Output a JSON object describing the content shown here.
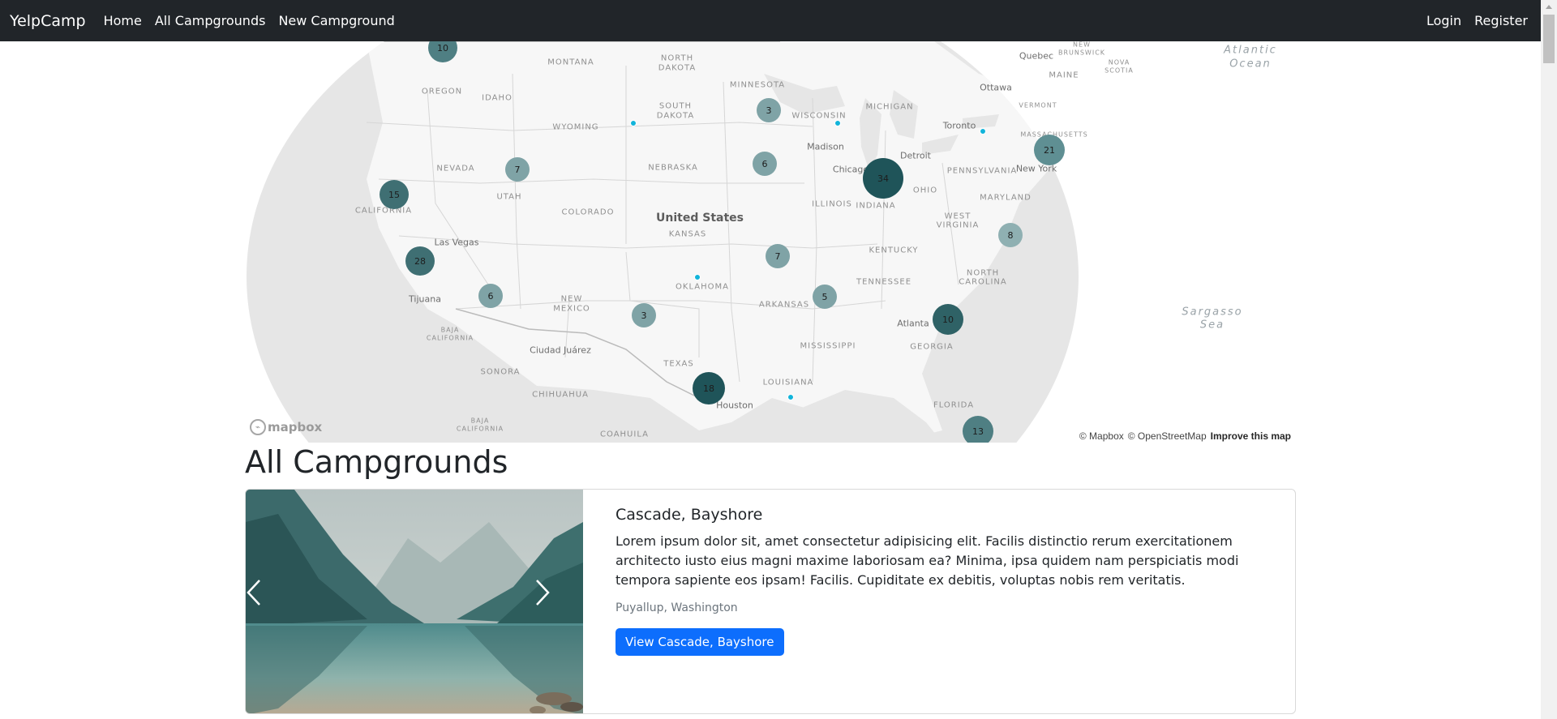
{
  "navbar": {
    "brand": "YelpCamp",
    "links": [
      {
        "label": "Home"
      },
      {
        "label": "All Campgrounds"
      },
      {
        "label": "New Campground"
      }
    ],
    "right_links": [
      {
        "label": "Login"
      },
      {
        "label": "Register"
      }
    ]
  },
  "map": {
    "labels": {
      "montana": "MONTANA",
      "north_dakota_1": "NORTH",
      "north_dakota_2": "DAKOTA",
      "south_dakota_1": "SOUTH",
      "south_dakota_2": "DAKOTA",
      "minnesota": "MINNESOTA",
      "wisconsin": "WISCONSIN",
      "michigan": "MICHIGAN",
      "oregon": "OREGON",
      "idaho": "IDAHO",
      "wyoming": "WYOMING",
      "nevada": "NEVADA",
      "utah": "UTAH",
      "colorado": "COLORADO",
      "nebraska": "NEBRASKA",
      "kansas": "KANSAS",
      "illinois": "ILLINOIS",
      "indiana": "INDIANA",
      "ohio": "OHIO",
      "pennsylvania": "PENNSYLVANIA",
      "california": "CALIFORNIA",
      "oklahoma": "OKLAHOMA",
      "new_mexico_1": "NEW",
      "new_mexico_2": "MEXICO",
      "arkansas": "ARKANSAS",
      "tennessee": "TENNESSEE",
      "kentucky": "KENTUCKY",
      "west_virginia_1": "WEST",
      "west_virginia_2": "VIRGINIA",
      "maryland": "MARYLAND",
      "north_carolina_1": "NORTH",
      "north_carolina_2": "CAROLINA",
      "georgia": "GEORGIA",
      "mississippi": "MISSISSIPPI",
      "texas": "TEXAS",
      "louisiana": "LOUISIANA",
      "florida": "FLORIDA",
      "sonora": "SONORA",
      "chihuahua": "CHIHUAHUA",
      "coahuila": "COAHUILA",
      "baja_1": "BAJA",
      "baja_2": "CALIFORNIA",
      "baja_sur_1": "BAJA",
      "baja_sur_2": "CALIFORNIA",
      "maine": "MAINE",
      "vermont": "VERMONT",
      "massachusetts": "MASSACHUSETTS",
      "new_brunswick_1": "NEW",
      "new_brunswick_2": "BRUNSWICK",
      "nova_scotia_1": "NOVA",
      "nova_scotia_2": "SCOTIA",
      "united_states": "United States",
      "las_vegas": "Las Vegas",
      "tijuana": "Tijuana",
      "ciudad_juarez": "Ciudad Juárez",
      "houston": "Houston",
      "atlanta": "Atlanta",
      "chicago": "Chicago",
      "detroit": "Detroit",
      "madison": "Madison",
      "toronto": "Toronto",
      "ottawa": "Ottawa",
      "quebec": "Quebec",
      "new_york": "New York",
      "atlantic_1": "Atlantic",
      "atlantic_2": "Ocean",
      "sargasso_1": "Sargasso",
      "sargasso_2": "Sea"
    },
    "clusters": [
      {
        "count": "10"
      },
      {
        "count": "3"
      },
      {
        "count": "6"
      },
      {
        "count": "7"
      },
      {
        "count": "15"
      },
      {
        "count": "34"
      },
      {
        "count": "21"
      },
      {
        "count": "28"
      },
      {
        "count": "7"
      },
      {
        "count": "8"
      },
      {
        "count": "6"
      },
      {
        "count": "5"
      },
      {
        "count": "3"
      },
      {
        "count": "10"
      },
      {
        "count": "18"
      },
      {
        "count": "13"
      }
    ],
    "logo_text": "mapbox",
    "attribution": {
      "mapbox": "© Mapbox",
      "osm": "© OpenStreetMap",
      "improve": "Improve this map"
    }
  },
  "page": {
    "title": "All Campgrounds"
  },
  "campgrounds": [
    {
      "title": "Cascade, Bayshore",
      "description": "Lorem ipsum dolor sit, amet consectetur adipisicing elit. Facilis distinctio rerum exercitationem architecto iusto eius magni maxime laboriosam ea? Minima, ipsa quidem nam perspiciatis modi tempora sapiente eos ipsam! Facilis. Cupiditate ex debitis, voluptas nobis rem veritatis.",
      "location": "Puyallup, Washington",
      "button_label": "View Cascade, Bayshore"
    }
  ],
  "colors": {
    "navbar": "#212529",
    "primary": "#0d6efd",
    "cluster_small": "#7fa3a6",
    "cluster_medium": "#3f6f73",
    "cluster_large": "#1f5459",
    "pin": "#11b4da"
  }
}
